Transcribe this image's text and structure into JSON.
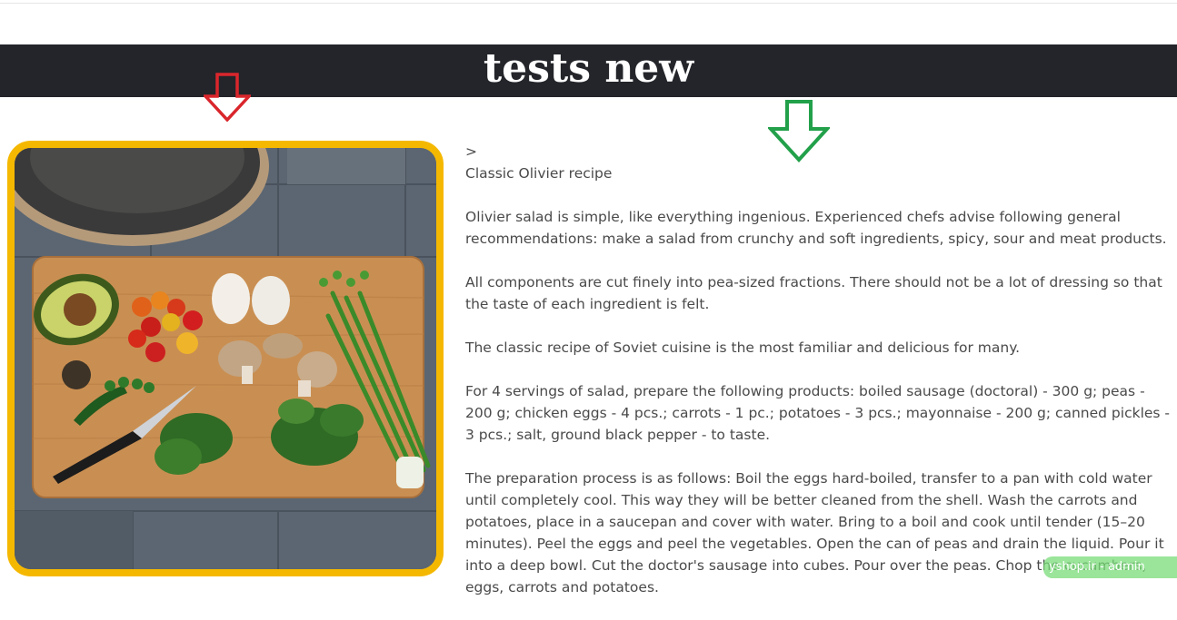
{
  "banner": {
    "title": "tests new"
  },
  "breadcrumb": {
    "separator": ">"
  },
  "recipe": {
    "title": "Classic Olivier recipe",
    "paragraphs": [
      "Olivier salad is simple, like everything ingenious. Experienced chefs advise following general recommendations: make a salad from crunchy and soft ingredients, spicy, sour and meat products.",
      "All components are cut finely into pea-sized fractions. There should not be a lot of dressing so that the taste of each ingredient is felt.",
      "The classic recipe of Soviet cuisine is the most familiar and delicious for many.",
      "For 4 servings of salad, prepare the following products: boiled sausage (doctoral) - 300 g; peas - 200 g; chicken eggs - 4 pcs.; carrots - 1 pc.; potatoes - 3 pcs.; mayonnaise - 200 g; canned pickles - 3 pcs.; salt, ground black pepper - to taste.",
      "The preparation process is as follows: Boil the eggs hard-boiled, transfer to a pan with cold water until completely cool. This way they will be better cleaned from the shell. Wash the carrots and potatoes, place in a saucepan and cover with water. Bring to a boil and cook until tender (15–20 minutes). Peel the eggs and peel the vegetables. Open the can of peas and drain the liquid. Pour it into a deep bowl. Cut the doctor's sausage into cubes. Pour over the peas. Chop the cucumbers, eggs, carrots and potatoes."
    ]
  },
  "watermark": {
    "text": "yshop.ir - admin"
  },
  "colors": {
    "banner_bg": "#23252a",
    "frame_border": "#f5b800",
    "arrow_red": "#d9262c",
    "arrow_green": "#22a04a"
  },
  "icons": {
    "red_arrow": "arrow-down-outline-icon",
    "green_arrow": "arrow-down-outline-icon"
  }
}
